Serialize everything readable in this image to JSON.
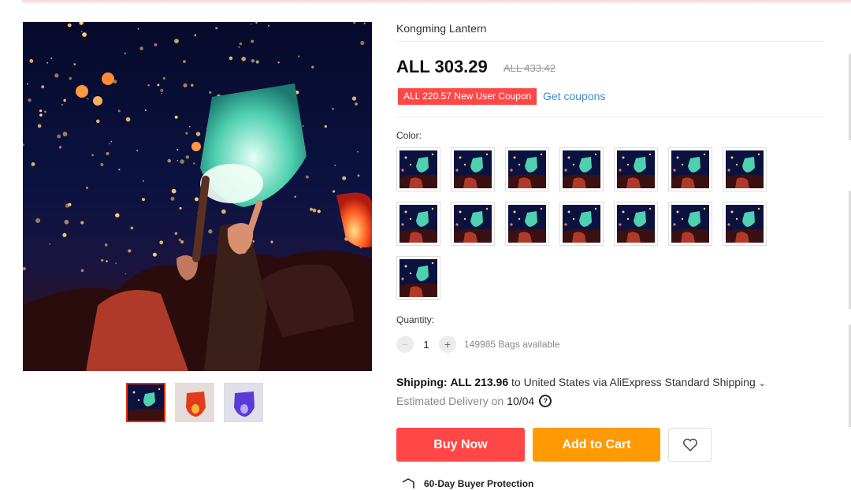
{
  "product": {
    "title": "Kongming Lantern",
    "price": "ALL 303.29",
    "original_price": "ALL 433.42",
    "coupon_badge": "ALL 220.57 New User Coupon",
    "get_coupons": "Get coupons",
    "color_label": "Color:",
    "quantity_label": "Quantity:",
    "quantity_value": "1",
    "quantity_minus": "−",
    "quantity_plus": "+",
    "availability": "149985 Bags available",
    "swatch_count": 15
  },
  "shipping": {
    "label": "Shipping:",
    "price": "ALL 213.96",
    "rest": "to United States via AliExpress Standard Shipping",
    "delivery_label": "Estimated Delivery on",
    "delivery_date": "10/04"
  },
  "actions": {
    "buy_now": "Buy Now",
    "add_to_cart": "Add to Cart"
  },
  "protection": {
    "label": "60-Day Buyer Protection"
  },
  "colors": {
    "accent_red": "#ff4747",
    "accent_orange": "#ff9a05",
    "link_blue": "#3a8fc9"
  },
  "icons": [
    "chevron-down-icon",
    "question-icon",
    "heart-icon",
    "shield-icon",
    "minus-icon",
    "plus-icon"
  ]
}
